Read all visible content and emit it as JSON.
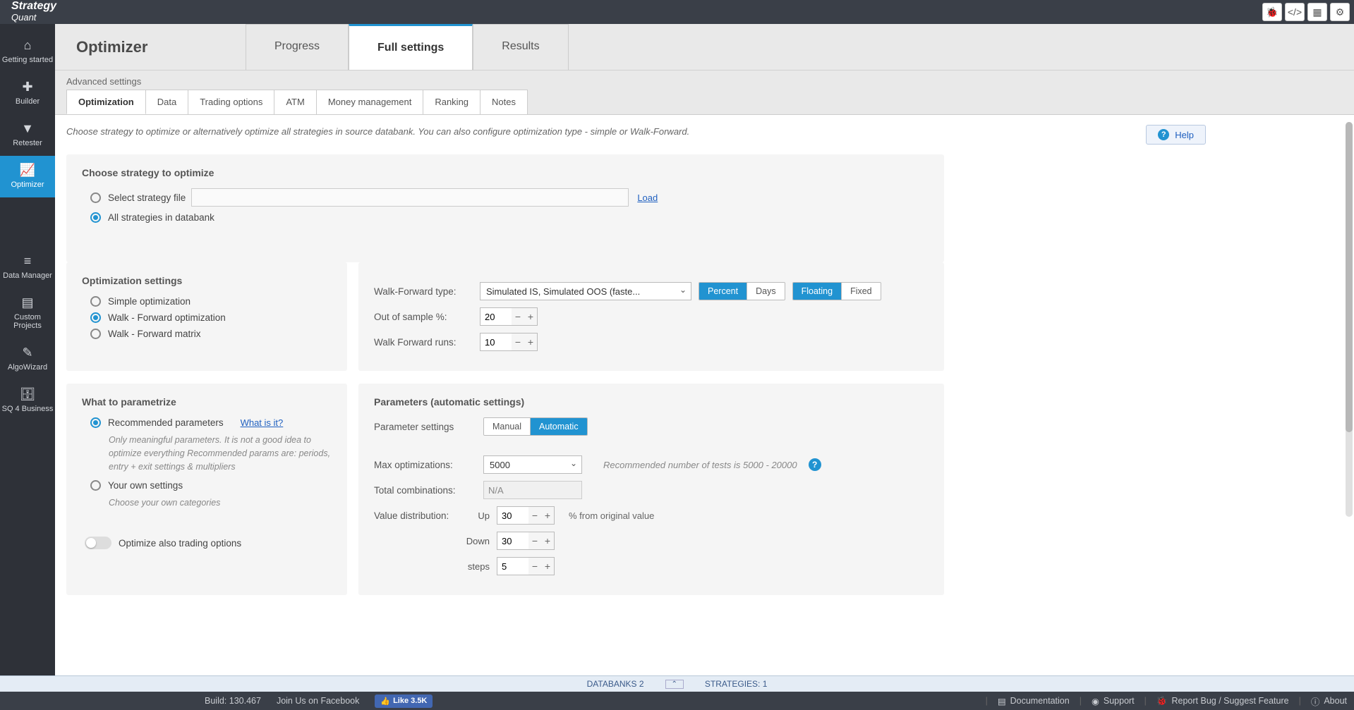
{
  "logo": "StrategyQuant",
  "sidebar": [
    {
      "icon": "⌂",
      "label": "Getting started"
    },
    {
      "icon": "✚",
      "label": "Builder"
    },
    {
      "icon": "▼",
      "label": "Retester"
    },
    {
      "icon": "📈",
      "label": "Optimizer"
    },
    {
      "icon": "≡",
      "label": "Data Manager"
    },
    {
      "icon": "▤",
      "label": "Custom Projects"
    },
    {
      "icon": "✎",
      "label": "AlgoWizard"
    },
    {
      "icon": "🗄",
      "label": "SQ 4 Business"
    }
  ],
  "page_title": "Optimizer",
  "main_tabs": [
    "Progress",
    "Full settings",
    "Results"
  ],
  "subtitle": "Advanced settings",
  "sub_tabs": [
    "Optimization",
    "Data",
    "Trading options",
    "ATM",
    "Money management",
    "Ranking",
    "Notes"
  ],
  "intro": "Choose strategy to optimize or alternatively optimize all strategies in source databank. You can also configure optimization type - simple or Walk-Forward.",
  "help_label": "Help",
  "strategy_panel": {
    "title": "Choose strategy to optimize",
    "opt_file": "Select strategy file",
    "opt_all": "All strategies in databank",
    "load": "Load"
  },
  "opt_settings": {
    "title": "Optimization settings",
    "simple": "Simple optimization",
    "wf": "Walk - Forward optimization",
    "matrix": "Walk - Forward matrix"
  },
  "wf_panel": {
    "type_label": "Walk-Forward type:",
    "type_value": "Simulated IS, Simulated OOS (faste...",
    "percent": "Percent",
    "days": "Days",
    "floating": "Floating",
    "fixed": "Fixed",
    "oos_label": "Out of sample %:",
    "oos_value": "20",
    "runs_label": "Walk Forward runs:",
    "runs_value": "10"
  },
  "parametrize": {
    "title": "What to parametrize",
    "rec": "Recommended parameters",
    "what": "What is it?",
    "rec_desc": "Only meaningful parameters. It is not a good idea to optimize everything\nRecommended params are: periods, entry + exit settings & multipliers",
    "own": "Your own settings",
    "own_desc": "Choose your own categories",
    "trading_opts": "Optimize also trading options"
  },
  "params": {
    "title": "Parameters (automatic settings)",
    "settings_label": "Parameter settings",
    "manual": "Manual",
    "automatic": "Automatic",
    "max_label": "Max optimizations:",
    "max_value": "5000",
    "max_note": "Recommended number of tests is 5000 - 20000",
    "total_label": "Total combinations:",
    "total_value": "N/A",
    "dist_label": "Value distribution:",
    "up": "Up",
    "up_value": "30",
    "down": "Down",
    "down_value": "30",
    "steps": "steps",
    "steps_value": "5",
    "percent_note": "% from original value"
  },
  "databank": {
    "label": "DATABANKS 2",
    "strategies": "STRATEGIES: 1"
  },
  "footer": {
    "build": "Build: 130.467",
    "fb": "Join Us on Facebook",
    "like": "Like 3.5K",
    "doc": "Documentation",
    "support": "Support",
    "bug": "Report Bug / Suggest Feature",
    "about": "About"
  }
}
